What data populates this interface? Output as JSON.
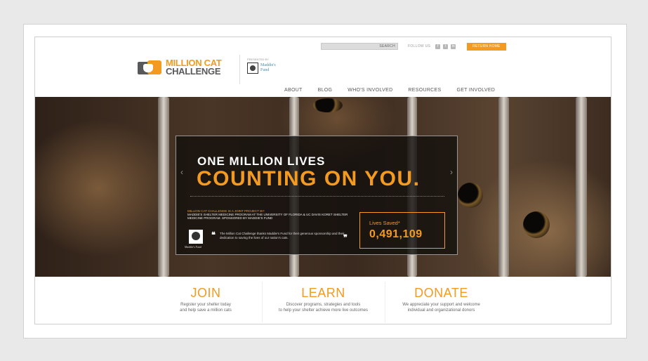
{
  "header": {
    "search_button": "SEARCH",
    "follow_label": "FOLLOW US",
    "social": [
      "f",
      "t",
      "in"
    ],
    "return_button": "RETURN HOME",
    "logo": {
      "line1": "MILLION CAT",
      "line2": "CHALLENGE"
    },
    "partner": {
      "caption": "PRESENTED BY",
      "name_line1": "Maddie's",
      "name_line2": "Fund"
    }
  },
  "nav": {
    "items": [
      "ABOUT",
      "BLOG",
      "WHO'S INVOLVED",
      "RESOURCES",
      "GET INVOLVED"
    ]
  },
  "hero": {
    "headline1": "ONE MILLION LIVES",
    "headline2": "COUNTING ON YOU.",
    "prev_arrow": "‹",
    "next_arrow": "›",
    "org_highlight": "MILLION CAT CHALLENGE IS A JOINT PROJECT BY:",
    "org_line": "MADDIE'S SHELTER MEDICINE PROGRAM AT THE UNIVERSITY OF FLORIDA & UC DAVIS KORET SHELTER MEDICINE PROGRAM. SPONSORED BY MADDIE'S FUND",
    "seal_caption": "Maddie's Fund",
    "quote": "The Million Cat Challenge thanks Maddie's Fund for their generous sponsorship and their dedication to saving the lives of our nation's cats.",
    "open_quote": "❝",
    "close_quote": "❞",
    "counter_label": "Lives Saved*",
    "counter_value": "0,491,109"
  },
  "ctas": [
    {
      "title": "JOIN",
      "line1": "Register your shelter today",
      "line2": "and help save a million cats"
    },
    {
      "title": "LEARN",
      "line1": "Discover programs, strategies and tools",
      "line2": "to help your shelter achieve more live outcomes"
    },
    {
      "title": "DONATE",
      "line1": "We appreciate your support and welcome",
      "line2": "individual and organizational donors"
    }
  ],
  "colors": {
    "accent": "#f39a21",
    "logo_gray": "#58595b"
  }
}
